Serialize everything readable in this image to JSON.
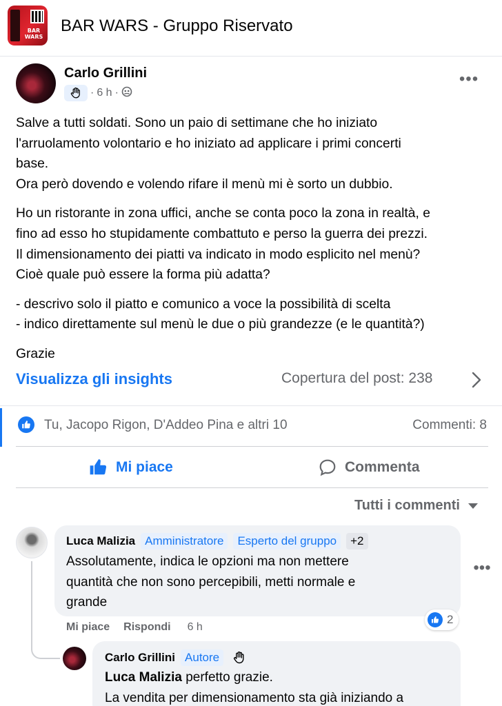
{
  "header": {
    "group_title": "BAR WARS - Gruppo Riservato",
    "logo_text": "BAR WARS"
  },
  "post": {
    "author": "Carlo Grillini",
    "time": "6 h",
    "separator": "·",
    "paragraphs": [
      [
        "Salve a tutti soldati. Sono un paio di settimane che ho iniziato",
        "l'arruolamento volontario e ho iniziato ad applicare i primi concerti",
        "base.",
        "Ora però dovendo e volendo rifare il menù mi è sorto un dubbio."
      ],
      [
        "Ho un ristorante in zona uffici, anche se conta poco la zona in realtà, e",
        "fino ad esso ho stupidamente combattuto e perso la guerra dei prezzi.",
        "Il dimensionamento dei piatti va indicato in modo esplicito nel menù?",
        "Cioè quale può essere la forma più adatta?"
      ],
      [
        "- descrivo solo il piatto e comunico a voce la possibilità di scelta",
        "- indico direttamente sul menù le due o più grandezze (e le quantità?)"
      ],
      [
        "Grazie"
      ]
    ]
  },
  "insights": {
    "link_label": "Visualizza gli insights",
    "reach_label": "Copertura del post: 238"
  },
  "reactions": {
    "reactors": "Tu, Jacopo Rigon, D'Addeo Pina e altri 10",
    "comments": "Commenti: 8"
  },
  "actions": {
    "like_label": "Mi piace",
    "comment_label": "Commenta"
  },
  "comments_sort": "Tutti i commenti",
  "comments": [
    {
      "name": "Luca Malizia",
      "badges": [
        "Amministratore",
        "Esperto del gruppo"
      ],
      "extra_badges": "+2",
      "lines": [
        "Assolutamente, indica le opzioni ma non mettere",
        "quantità che non sono percepibili, metti normale e",
        "grande"
      ],
      "reaction_count": "2",
      "like_label": "Mi piace",
      "reply_label": "Rispondi",
      "time": "6 h"
    },
    {
      "name": "Carlo Grillini",
      "badge": "Autore",
      "mention": "Luca Malizia",
      "first_line_rest": " perfetto grazie.",
      "second_line": "La vendita per dimensionamento sta già iniziando a"
    }
  ],
  "colors": {
    "accent": "#1877f2",
    "secondary_text": "#65676b",
    "bubble": "#f0f2f5",
    "logo_red": "#e0252f"
  },
  "icons": [
    "like-icon",
    "comment-icon",
    "more-icon",
    "chevron-right-icon",
    "caret-down-icon",
    "group-privacy-icon",
    "wave-hand-icon"
  ]
}
